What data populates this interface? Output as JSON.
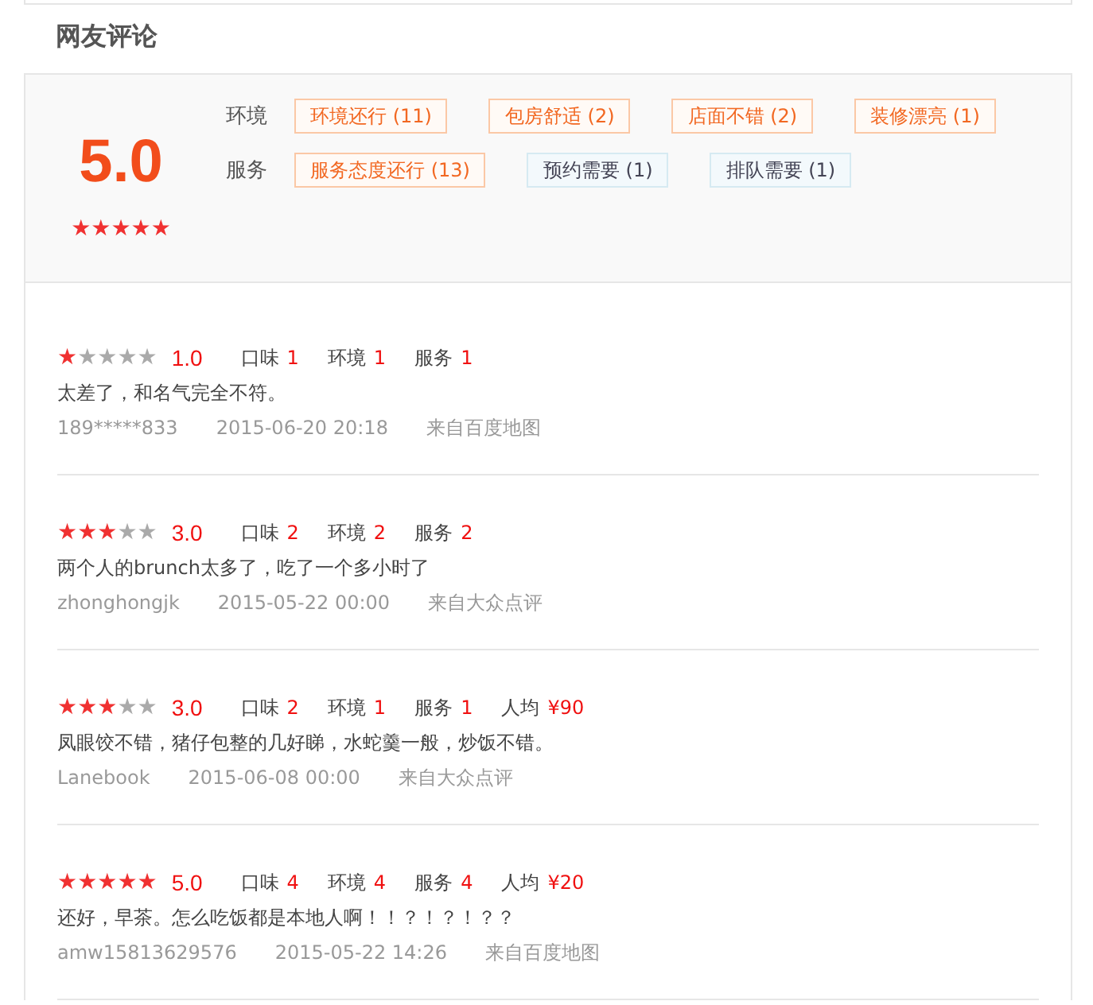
{
  "section_title": "网友评论",
  "summary": {
    "score": "5.0",
    "stars": 5,
    "tag_groups": [
      {
        "label": "环境",
        "tags": [
          {
            "text": "环境还行 (11)",
            "kind": "positive"
          },
          {
            "text": "包房舒适 (2)",
            "kind": "positive"
          },
          {
            "text": "店面不错 (2)",
            "kind": "positive"
          },
          {
            "text": "装修漂亮 (1)",
            "kind": "positive"
          }
        ]
      },
      {
        "label": "服务",
        "tags": [
          {
            "text": "服务态度还行 (13)",
            "kind": "positive"
          },
          {
            "text": "预约需要 (1)",
            "kind": "neutral"
          },
          {
            "text": "排队需要 (1)",
            "kind": "neutral"
          }
        ]
      }
    ]
  },
  "reviews": [
    {
      "stars": 1,
      "score": "1.0",
      "ratings": [
        {
          "label": "口味",
          "value": "1"
        },
        {
          "label": "环境",
          "value": "1"
        },
        {
          "label": "服务",
          "value": "1"
        }
      ],
      "comment": "太差了，和名气完全不符。",
      "user": "189*****833",
      "time": "2015-06-20 20:18",
      "source": "来自百度地图"
    },
    {
      "stars": 3,
      "score": "3.0",
      "ratings": [
        {
          "label": "口味",
          "value": "2"
        },
        {
          "label": "环境",
          "value": "2"
        },
        {
          "label": "服务",
          "value": "2"
        }
      ],
      "comment": "两个人的brunch太多了，吃了一个多小时了",
      "user": "zhonghongjk",
      "time": "2015-05-22 00:00",
      "source": "来自大众点评"
    },
    {
      "stars": 3,
      "score": "3.0",
      "ratings": [
        {
          "label": "口味",
          "value": "2"
        },
        {
          "label": "环境",
          "value": "1"
        },
        {
          "label": "服务",
          "value": "1"
        }
      ],
      "price_label": "人均",
      "price": "¥90",
      "comment": "凤眼饺不错，猪仔包整的几好睇，水蛇羹一般，炒饭不错。",
      "user": "Lanebook",
      "time": "2015-06-08 00:00",
      "source": "来自大众点评"
    },
    {
      "stars": 5,
      "score": "5.0",
      "ratings": [
        {
          "label": "口味",
          "value": "4"
        },
        {
          "label": "环境",
          "value": "4"
        },
        {
          "label": "服务",
          "value": "4"
        }
      ],
      "price_label": "人均",
      "price": "¥20",
      "comment": "还好，早茶。怎么吃饭都是本地人啊！！？！？！？？",
      "user": "amw15813629576",
      "time": "2015-05-22 14:26",
      "source": "来自百度地图"
    }
  ]
}
